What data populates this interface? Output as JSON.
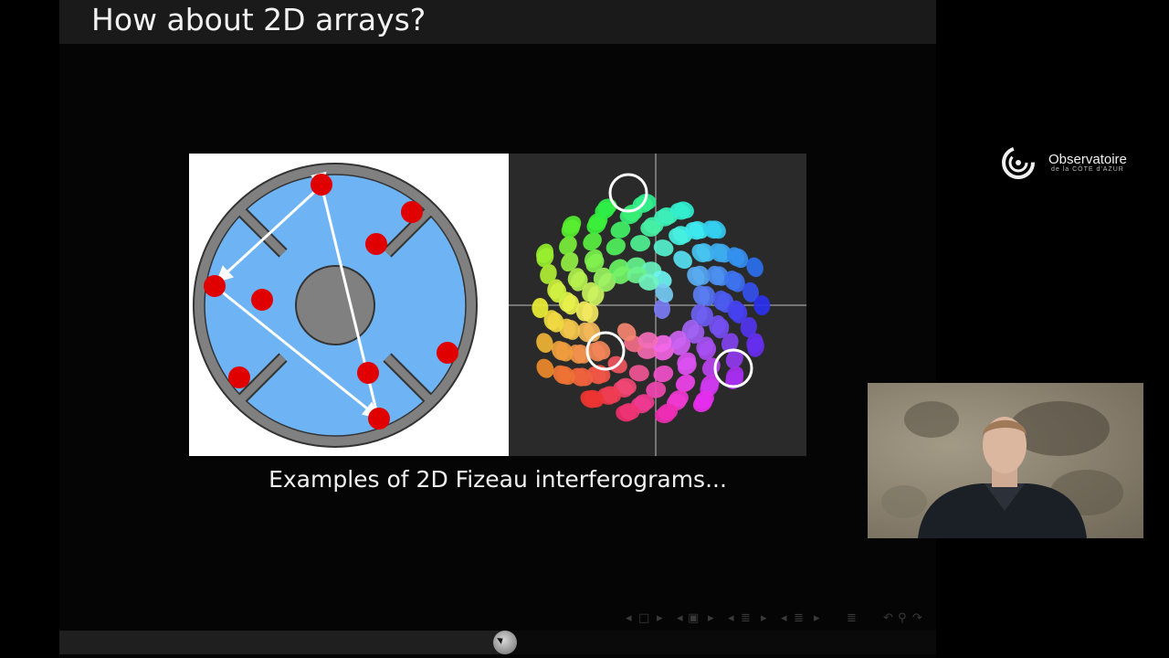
{
  "slide": {
    "title": "How about 2D arrays?",
    "caption": "Examples of 2D Fizeau interferograms..."
  },
  "navigation": {
    "icons": [
      "arrow-left-icon",
      "frame-icon",
      "arrow-right-icon",
      "arrow-left-icon",
      "subsection-icon",
      "arrow-right-icon",
      "arrow-left-icon",
      "section-icon",
      "arrow-right-icon",
      "arrow-left-icon",
      "section-icon",
      "arrow-right-icon",
      "appendix-icon",
      "back-icon",
      "search-icon",
      "forward-icon"
    ]
  },
  "player": {
    "progress": 0.508
  },
  "logo": {
    "name": "Observatoire",
    "subtitle": "de la CÔTE d'AZUR"
  },
  "colors": {
    "pupil_blue": "#6eb4f5",
    "pupil_grey": "#808080",
    "aperture_red": "#e00000",
    "background": "#000000"
  }
}
